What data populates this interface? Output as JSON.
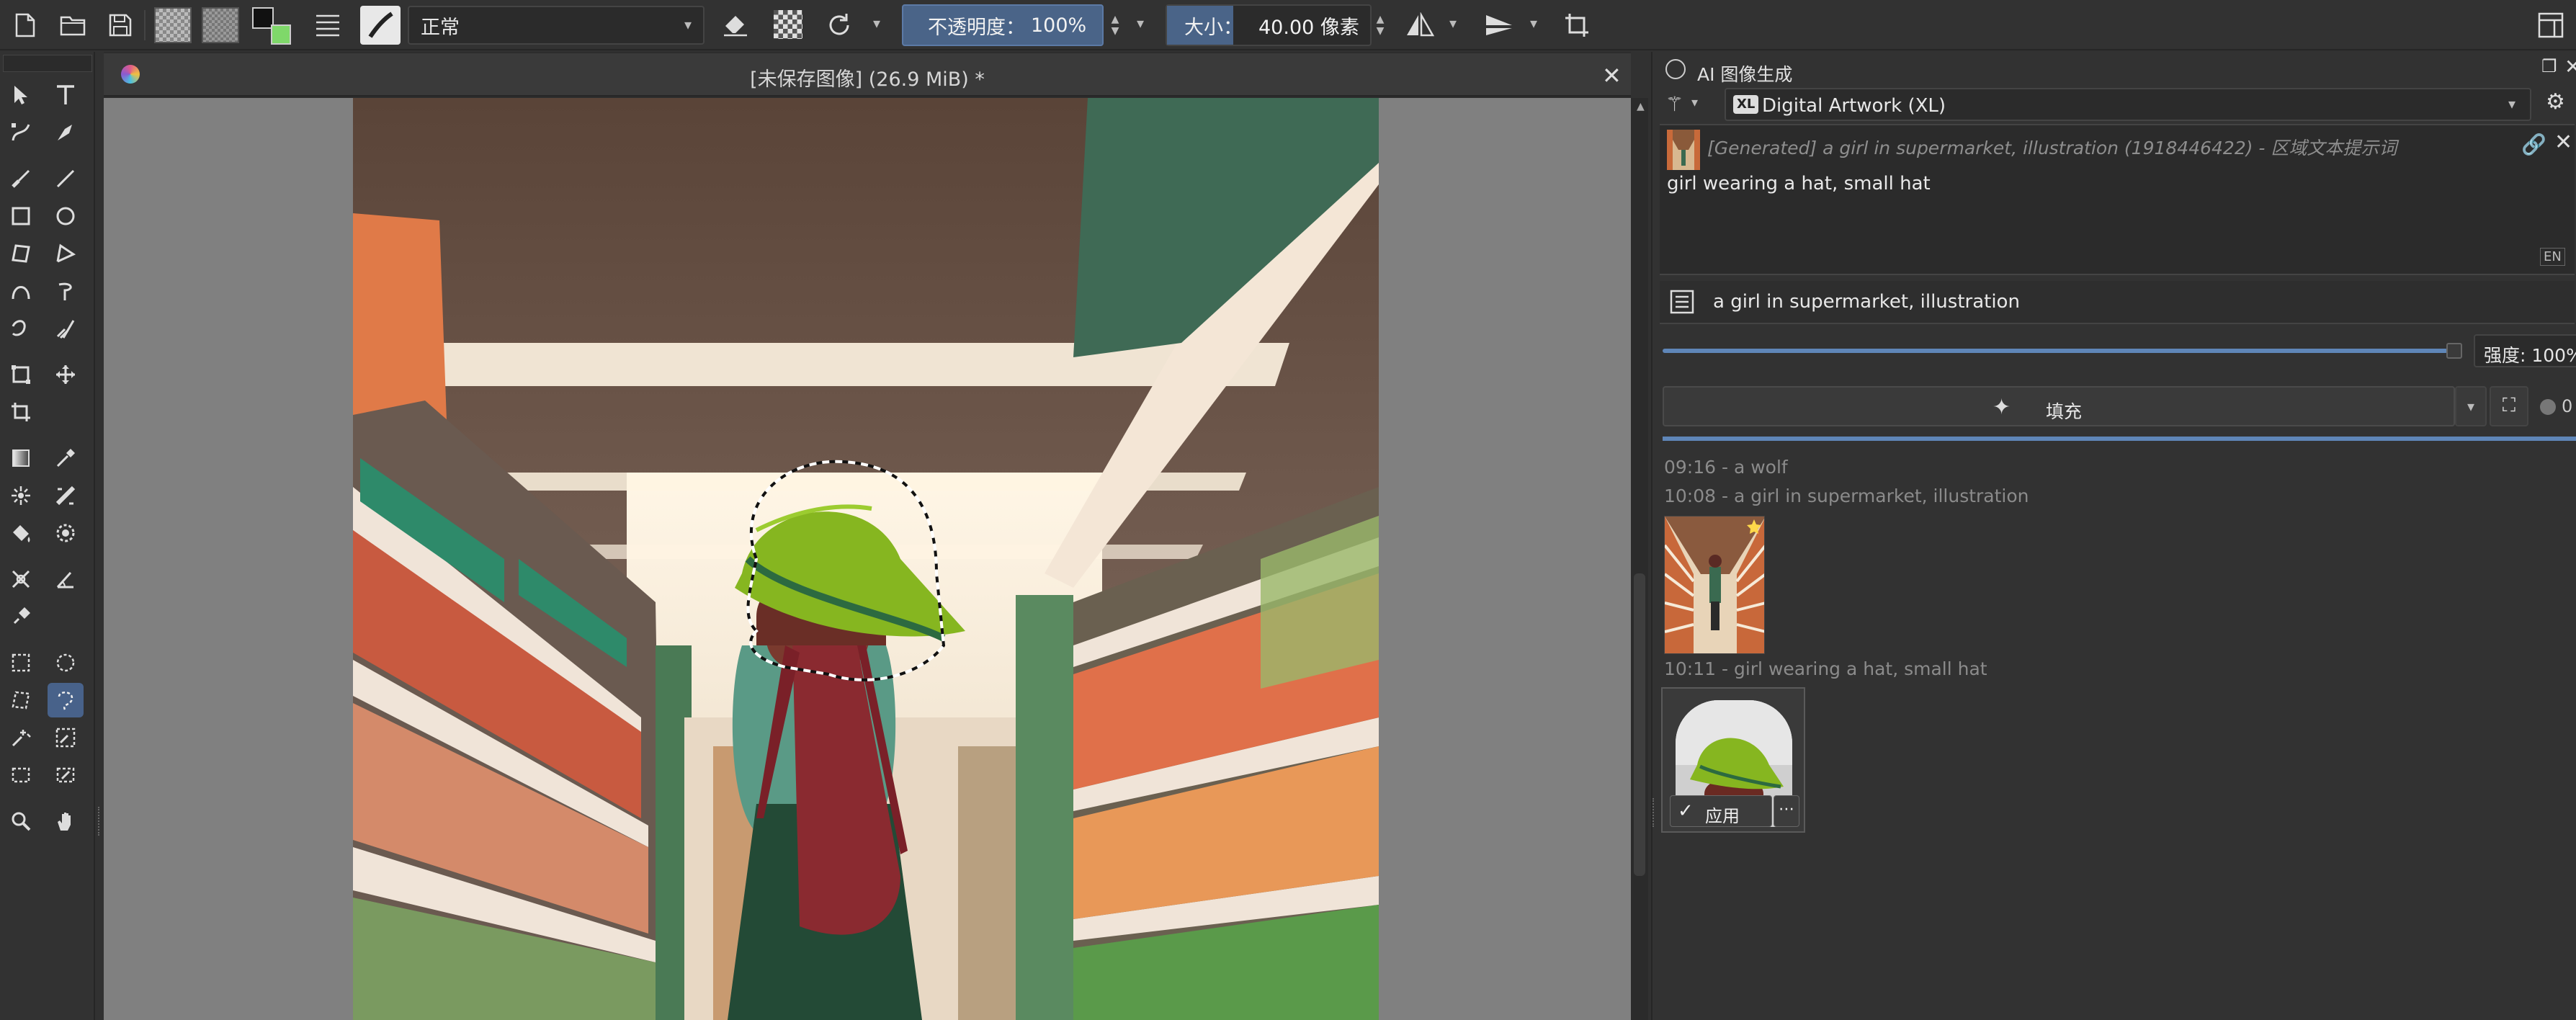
{
  "toolbar": {
    "blend_mode": "正常",
    "opacity_label": "不透明度：",
    "opacity_value": "100%",
    "size_label": "大小：",
    "size_value": "40.00 像素"
  },
  "document": {
    "title": "[未保存图像] (26.9 MiB) *"
  },
  "docker": {
    "title": "AI 图像生成",
    "workspace": "Digital Artwork (XL)",
    "workspace_badge": "XL",
    "region_header": "[Generated] a girl in supermarket, illustration (1918446422) - 区域文本提示词",
    "region_prompt": "girl wearing a hat, small hat",
    "lang_badge": "EN",
    "root_prompt": "a girl in supermarket, illustration",
    "strength_label": "强度: 100%",
    "fill_label": "填充",
    "queue_count": "0",
    "history": [
      {
        "time": "09:16 - a wolf"
      },
      {
        "time": "10:08 - a girl in supermarket, illustration"
      },
      {
        "time": "10:11 - girl wearing a hat, small hat"
      }
    ],
    "apply_label": "应用"
  },
  "colors": {
    "accent": "#4a6488",
    "panel": "#323232",
    "canvas_bg": "#808080"
  }
}
